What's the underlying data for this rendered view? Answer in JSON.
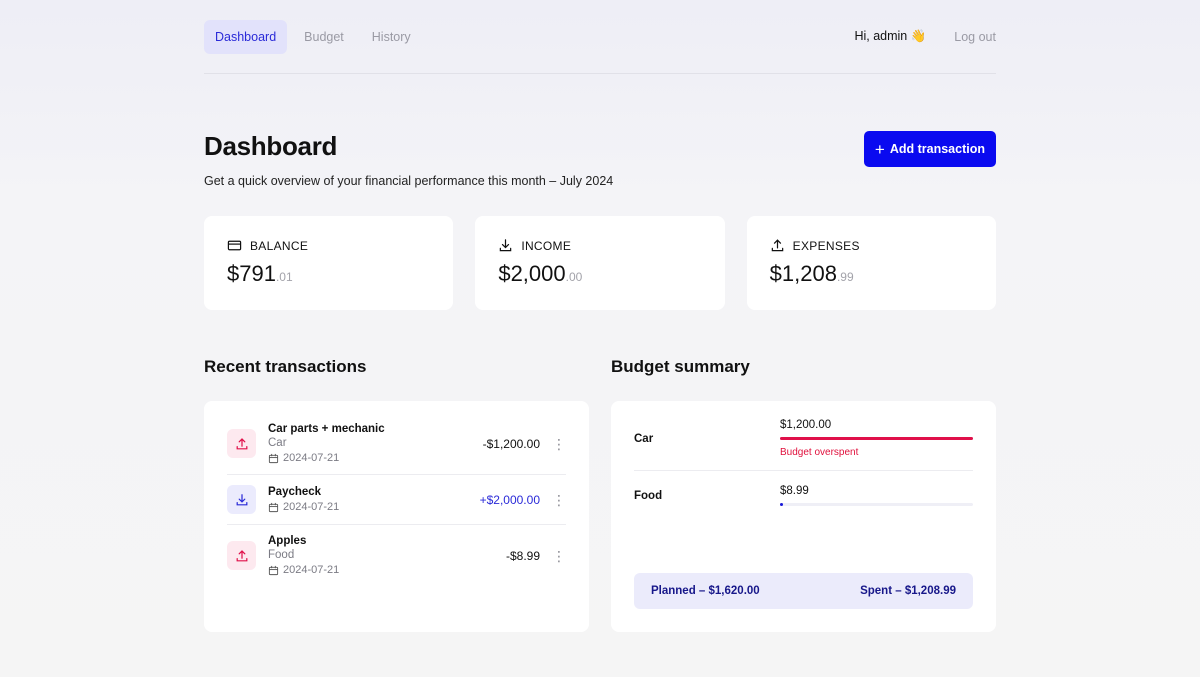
{
  "nav": {
    "links": [
      "Dashboard",
      "Budget",
      "History"
    ],
    "active": "Dashboard",
    "greeting": "Hi, admin 👋",
    "logout": "Log out"
  },
  "header": {
    "title": "Dashboard",
    "subtitle": "Get a quick overview of your financial performance this month – July 2024",
    "add_button": "Add transaction"
  },
  "stats": [
    {
      "label": "BALANCE",
      "icon": "credit-card-icon",
      "dollars": "$791",
      "cents": ".01"
    },
    {
      "label": "INCOME",
      "icon": "download-icon",
      "dollars": "$2,000",
      "cents": ".00"
    },
    {
      "label": "EXPENSES",
      "icon": "upload-icon",
      "dollars": "$1,208",
      "cents": ".99"
    }
  ],
  "transactions": {
    "title": "Recent transactions",
    "items": [
      {
        "name": "Car parts + mechanic",
        "category": "Car",
        "date": "2024-07-21",
        "amount": "-$1,200.00",
        "type": "expense"
      },
      {
        "name": "Paycheck",
        "category": "",
        "date": "2024-07-21",
        "amount": "+$2,000.00",
        "type": "income"
      },
      {
        "name": "Apples",
        "category": "Food",
        "date": "2024-07-21",
        "amount": "-$8.99",
        "type": "expense"
      }
    ]
  },
  "budget": {
    "title": "Budget summary",
    "items": [
      {
        "name": "Car",
        "amount": "$1,200.00",
        "progress": 1.0,
        "warning": "Budget overspent",
        "color": "#e0104a"
      },
      {
        "name": "Food",
        "amount": "$8.99",
        "progress": 0.015,
        "warning": "",
        "color": "#1818d8"
      }
    ],
    "planned": "Planned – $1,620.00",
    "spent": "Spent – $1,208.99"
  },
  "colors": {
    "accent": "#0a0af0",
    "danger": "#e0104a"
  }
}
